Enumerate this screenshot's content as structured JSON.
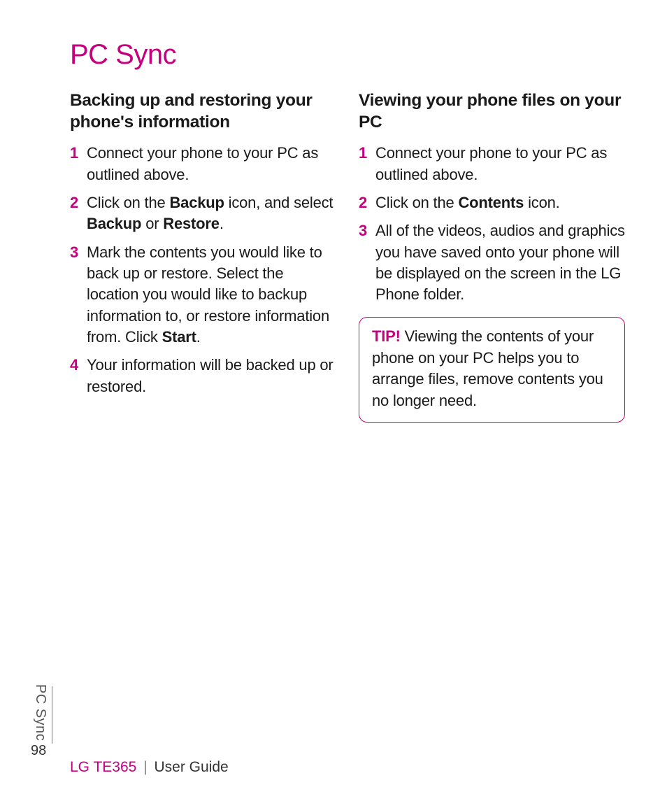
{
  "page_title": "PC Sync",
  "left": {
    "heading": "Backing up and restoring your phone's information",
    "steps": [
      {
        "num": "1",
        "parts": [
          "Connect your phone to your PC as outlined above."
        ]
      },
      {
        "num": "2",
        "parts": [
          "Click on the ",
          "Backup",
          " icon, and select ",
          "Backup",
          " or ",
          "Restore",
          "."
        ]
      },
      {
        "num": "3",
        "parts": [
          "Mark the contents you would like to back up or restore. Select the location you would like to backup information to, or restore information from. Click ",
          "Start",
          "."
        ]
      },
      {
        "num": "4",
        "parts": [
          "Your information will be backed up or restored."
        ]
      }
    ]
  },
  "right": {
    "heading": "Viewing your phone files on your PC",
    "steps": [
      {
        "num": "1",
        "parts": [
          "Connect your phone to your PC as outlined above."
        ]
      },
      {
        "num": "2",
        "parts": [
          "Click on the ",
          "Contents",
          " icon."
        ]
      },
      {
        "num": "3",
        "parts": [
          "All of the videos, audios and graphics you have saved onto your phone will be displayed on the screen in the LG Phone folder."
        ]
      }
    ],
    "tip_label": "TIP!",
    "tip_text": " Viewing the contents of your phone on your PC helps you to arrange files, remove contents you no longer need."
  },
  "side_tab": "PC Sync",
  "page_number": "98",
  "footer": {
    "model": "LG TE365",
    "separator": "|",
    "guide": "User Guide"
  }
}
